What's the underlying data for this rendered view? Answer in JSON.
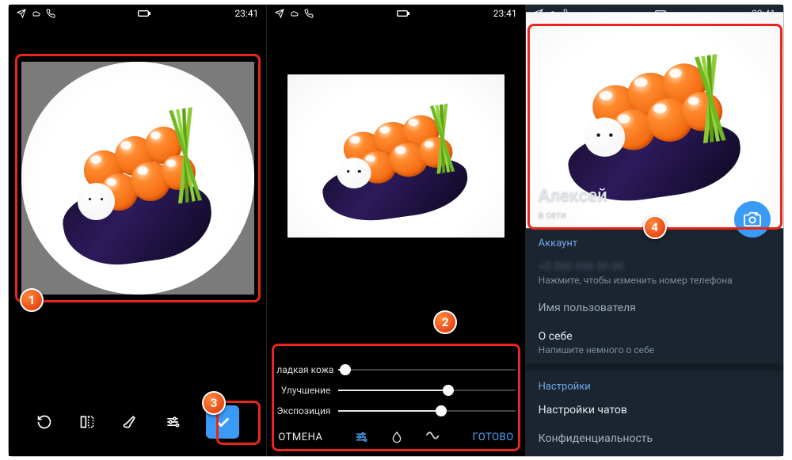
{
  "status": {
    "time": "23:41"
  },
  "badges": {
    "b1": "1",
    "b2": "2",
    "b3": "3",
    "b4": "4"
  },
  "phone2": {
    "sliders": [
      {
        "label": "ладкая кожа",
        "value": 4
      },
      {
        "label": "Улучшение",
        "value": 62
      },
      {
        "label": "Экспозиция",
        "value": 58
      }
    ],
    "cancel": "ОТМЕНА",
    "done": "ГОТОВО"
  },
  "profile": {
    "name": "Алексей",
    "status": "в сети",
    "sections": {
      "account": "Аккаунт",
      "phone_hint": "Нажмите, чтобы изменить номер телефона",
      "username": "Имя пользователя",
      "about": "О себе",
      "about_hint": "Напишите немного о себе",
      "settings": "Настройки",
      "chats": "Настройки чатов",
      "privacy": "Конфиденциальность"
    }
  },
  "icons": {
    "plane": "plane-icon",
    "cloud": "cloud-icon",
    "viber": "viber-icon",
    "battery": "battery-icon",
    "rotate": "rotate-icon",
    "flip": "flip-icon",
    "brush": "brush-icon",
    "tune": "tune-icon",
    "check": "check-icon",
    "drop": "drop-icon",
    "wave": "wave-icon",
    "qr": "qr-icon",
    "more": "more-icon",
    "back": "back-icon",
    "camera": "camera-icon"
  }
}
